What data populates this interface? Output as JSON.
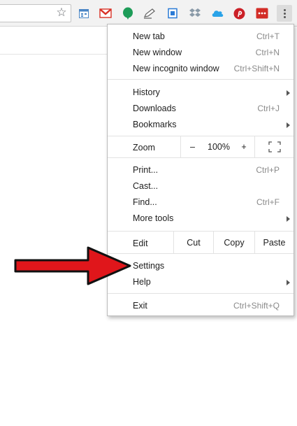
{
  "colors": {
    "arrow_fill": "#e0161b",
    "arrow_stroke": "#111111",
    "menu_text": "#202020",
    "shortcut_text": "#8a8a8a",
    "toolbar_bg": "#f2f2f2"
  },
  "toolbar": {
    "bookmark_icon": "star-outline-icon",
    "extensions": [
      {
        "icon": "calendar-icon",
        "color": "#4a86c5"
      },
      {
        "icon": "gmail-icon",
        "color": "#d93025"
      },
      {
        "icon": "evernote-icon",
        "color": "#1d9c58"
      },
      {
        "icon": "pencil-icon",
        "color": "#6a6a6a"
      },
      {
        "icon": "screen-share-icon",
        "color": "#2a7bd6"
      },
      {
        "icon": "dropbox-icon",
        "color": "#8a9aa8"
      },
      {
        "icon": "cloud-icon",
        "color": "#2aa3e8"
      },
      {
        "icon": "pinterest-icon",
        "color": "#cb2027"
      },
      {
        "icon": "lastpass-icon",
        "color": "#d32d27"
      }
    ],
    "menu_icon": "more-vert-icon"
  },
  "menu": {
    "new_tab": {
      "label": "New tab",
      "shortcut": "Ctrl+T"
    },
    "new_window": {
      "label": "New window",
      "shortcut": "Ctrl+N"
    },
    "new_incognito": {
      "label": "New incognito window",
      "shortcut": "Ctrl+Shift+N"
    },
    "history": {
      "label": "History"
    },
    "downloads": {
      "label": "Downloads",
      "shortcut": "Ctrl+J"
    },
    "bookmarks": {
      "label": "Bookmarks"
    },
    "zoom": {
      "label": "Zoom",
      "minus": "–",
      "value": "100%",
      "plus": "+",
      "fullscreen_icon": "fullscreen-icon"
    },
    "print": {
      "label": "Print...",
      "shortcut": "Ctrl+P"
    },
    "cast": {
      "label": "Cast..."
    },
    "find": {
      "label": "Find...",
      "shortcut": "Ctrl+F"
    },
    "more_tools": {
      "label": "More tools"
    },
    "edit": {
      "label": "Edit",
      "cut": "Cut",
      "copy": "Copy",
      "paste": "Paste"
    },
    "settings": {
      "label": "Settings"
    },
    "help": {
      "label": "Help"
    },
    "exit": {
      "label": "Exit",
      "shortcut": "Ctrl+Shift+Q"
    }
  },
  "annotation": {
    "icon": "red-arrow-icon"
  }
}
